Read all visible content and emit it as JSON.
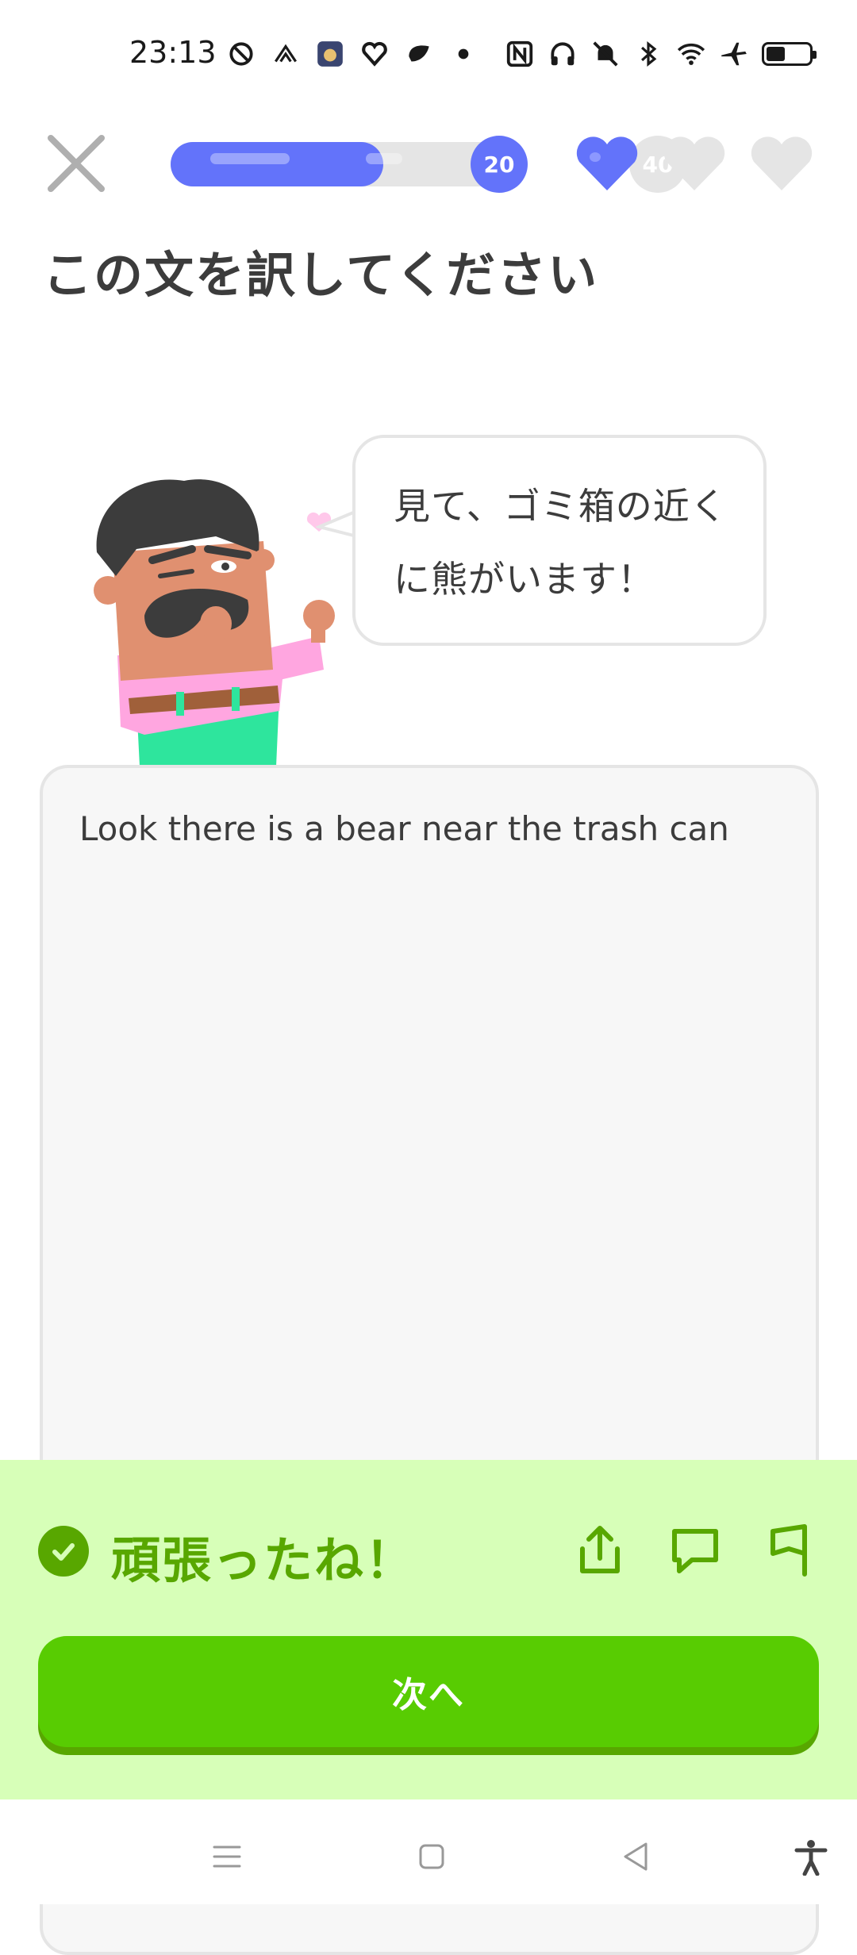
{
  "status_bar": {
    "time": "23:13",
    "left_icons": [
      "sync-icon",
      "signal-app-icon",
      "game-app-icon",
      "health-app-icon",
      "leaf-app-icon",
      "dot-icon"
    ],
    "right_icons": [
      "nfc-icon",
      "headphones-icon",
      "mute-icon",
      "bluetooth-icon",
      "wifi-icon",
      "airplane-icon",
      "battery-icon"
    ],
    "battery_level": 0.4
  },
  "header": {
    "progress": {
      "current_label": "20",
      "end_label": "40",
      "fill_fraction": 0.62
    },
    "hearts": {
      "total": 3,
      "filled": 1,
      "filled_color": "#6373fa",
      "empty_color": "#e5e5e5"
    }
  },
  "instruction": "この文を訳してください",
  "prompt": {
    "sentence": "見て、ゴミ箱の近くに熊がいます！"
  },
  "answer": {
    "text": "Look there is a bear near the trash can"
  },
  "feedback": {
    "title": "頑張ったね！",
    "actions": [
      "share-icon",
      "comment-icon",
      "report-flag-icon"
    ],
    "next_label": "次へ",
    "bg_color": "#d7ffb8",
    "accent_color": "#58a700"
  },
  "nav_bar": {
    "buttons": [
      "menu-icon",
      "home-icon",
      "back-icon",
      "accessibility-icon"
    ]
  }
}
